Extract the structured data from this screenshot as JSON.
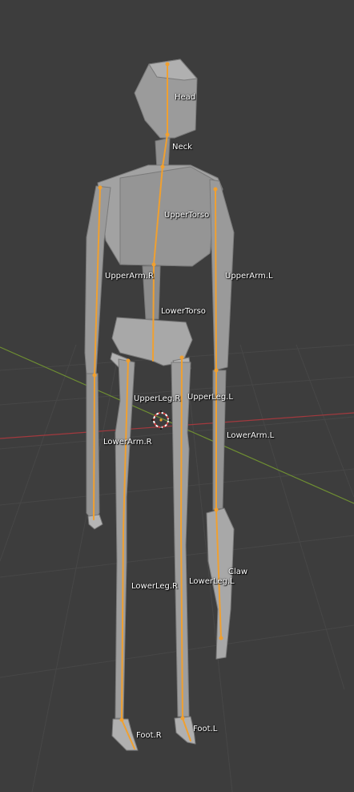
{
  "viewport": {
    "background": "#3d3d3d",
    "grid_color": "#4a4a4a",
    "x_axis_color": "#a3393e",
    "y_axis_color": "#6f8f32",
    "mesh_color": "#9a9a9a",
    "bone_color": "#f0a030"
  },
  "bones": [
    {
      "id": "head",
      "label": "Head"
    },
    {
      "id": "neck",
      "label": "Neck"
    },
    {
      "id": "upper-torso",
      "label": "UpperTorso"
    },
    {
      "id": "upper-arm-r",
      "label": "UpperArm.R"
    },
    {
      "id": "upper-arm-l",
      "label": "UpperArm.L"
    },
    {
      "id": "lower-torso",
      "label": "LowerTorso"
    },
    {
      "id": "upper-leg-r",
      "label": "UpperLeg.R"
    },
    {
      "id": "upper-leg-l",
      "label": "UpperLeg.L"
    },
    {
      "id": "lower-arm-r",
      "label": "LowerArm.R"
    },
    {
      "id": "lower-arm-l",
      "label": "LowerArm.L"
    },
    {
      "id": "claw",
      "label": "Claw"
    },
    {
      "id": "lower-leg-r",
      "label": "LowerLeg.R"
    },
    {
      "id": "lower-leg-l",
      "label": "LowerLeg.L"
    },
    {
      "id": "foot-r",
      "label": "Foot.R"
    },
    {
      "id": "foot-l",
      "label": "Foot.L"
    }
  ],
  "cursor_icon": "3d-cursor-icon"
}
